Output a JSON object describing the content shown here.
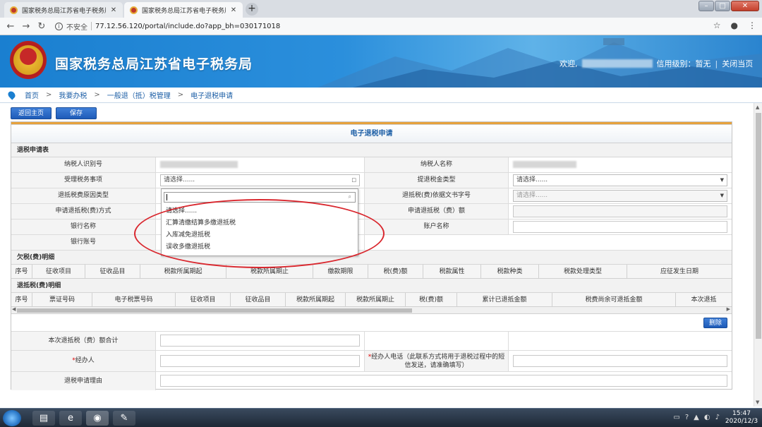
{
  "browser": {
    "tabs": [
      {
        "title": "国家税务总局江苏省电子税务局",
        "active": false
      },
      {
        "title": "国家税务总局江苏省电子税务局",
        "active": true
      }
    ],
    "new_tab_label": "+",
    "insecure_label": "不安全",
    "url": "77.12.56.120/portal/include.do?app_bh=030171018"
  },
  "site": {
    "title": "国家税务总局江苏省电子税务局",
    "welcome_label": "欢迎,",
    "credit_label": "信用级别：暂无",
    "close_page_label": "关闭当页"
  },
  "breadcrumb": [
    "首页",
    "我要办税",
    "一般退（抵）税管理",
    "电子退税申请"
  ],
  "toolbar": {
    "back_label": "返回主页",
    "save_label": "保存"
  },
  "form": {
    "title": "电子退税申请",
    "section_main": "退税申请表",
    "rows": [
      {
        "label": "纳税人识别号",
        "label2": "纳税人名称"
      },
      {
        "label": "受理税务事项",
        "select_value": "请选择......",
        "label2": "提退税金类型",
        "select2_value": "请选择......"
      },
      {
        "label": "退抵税费原因类型",
        "label2": "退抵税(费)依据文书字号",
        "select2_value": "请选择......"
      },
      {
        "label": "申请退抵税(费)方式",
        "label2": "申请退抵税（费）额"
      },
      {
        "label": "银行名称",
        "label2": "账户名称"
      },
      {
        "label": "银行账号"
      }
    ],
    "section_owed": "欠税(费)明细",
    "owed_columns": [
      "序号",
      "征收项目",
      "征收品目",
      "税款所属期起",
      "税款所属期止",
      "缴款期限",
      "税(费)额",
      "税款属性",
      "税款种类",
      "税款处理类型",
      "应征发生日期"
    ],
    "section_refund": "退抵税(费)明细",
    "refund_columns": [
      "序号",
      "票证号码",
      "电子税票号码",
      "征收项目",
      "征收品目",
      "税款所属期起",
      "税款所属期止",
      "税(费)额",
      "累计已退抵金额",
      "税费尚余可退抵金额",
      "本次退抵"
    ],
    "delete_label": "删除",
    "total_label": "本次退抵税（费）额合计",
    "agent_label": "经办人",
    "agent_required_mark": "*",
    "phone_label_required_mark": "*",
    "phone_label": "经办人电话（此联系方式将用于退税过程中的短信发送，请准确填写）",
    "reason_label": "退税申请理由"
  },
  "dropdown": {
    "options": [
      "请选择......",
      "汇算清缴结算多缴退抵税",
      "入库减免退抵税",
      "误收多缴退抵税"
    ]
  },
  "taskbar": {
    "time": "15:47",
    "date": "2020/12/3"
  }
}
